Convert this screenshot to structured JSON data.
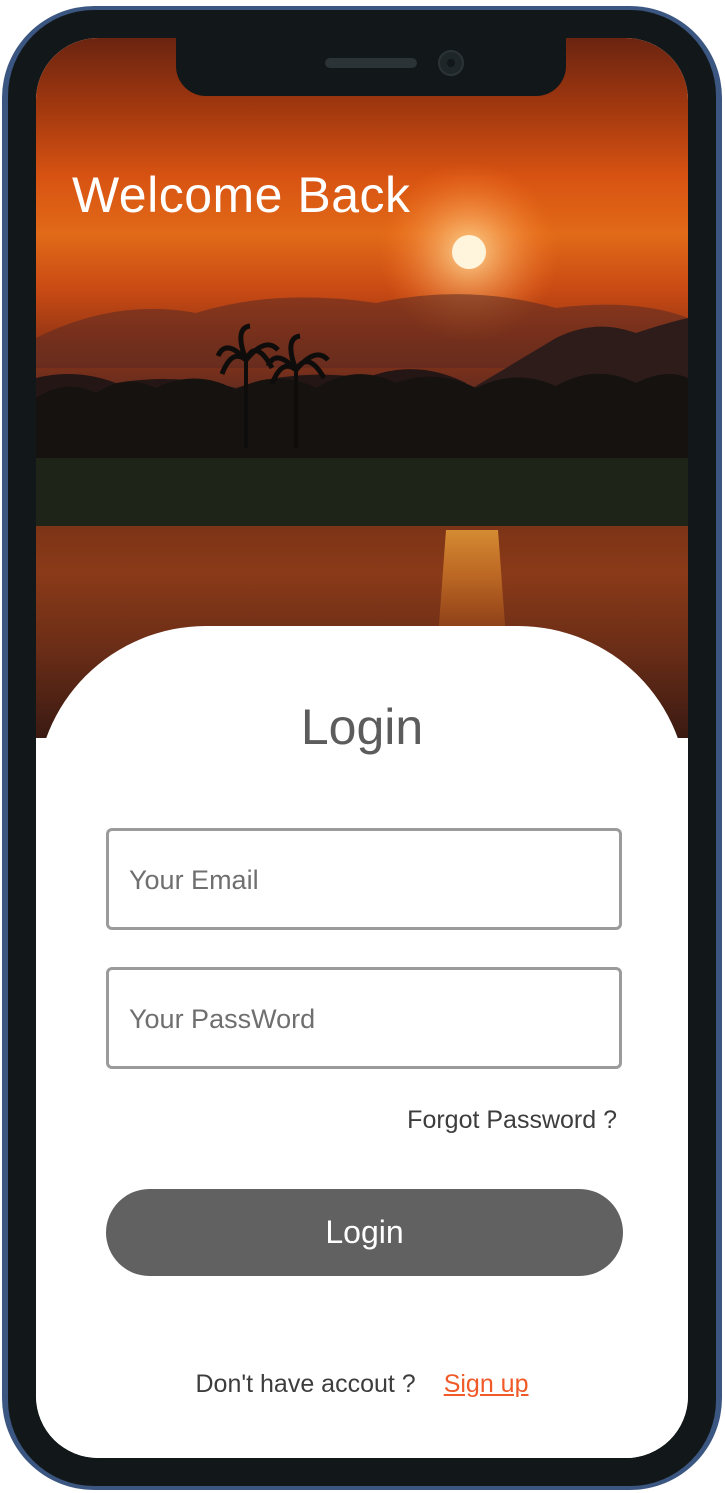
{
  "hero": {
    "title": "Welcome Back",
    "image": "sunset-over-river-with-palm-trees"
  },
  "login_card": {
    "heading": "Login",
    "email_field": {
      "placeholder": "Your Email",
      "value": ""
    },
    "password_field": {
      "placeholder": "Your PassWord",
      "value": ""
    },
    "forgot_password_label": "Forgot Password ?",
    "login_button_label": "Login",
    "no_account_text": "Don't have accout ?",
    "signup_label": "Sign up"
  },
  "colors": {
    "phone_frame": "#3b5681",
    "phone_body": "#12181a",
    "button_bg": "#616161",
    "signup_link": "#f05a28",
    "input_border": "#9b9b9b",
    "heading_text": "#5c5c5c"
  }
}
